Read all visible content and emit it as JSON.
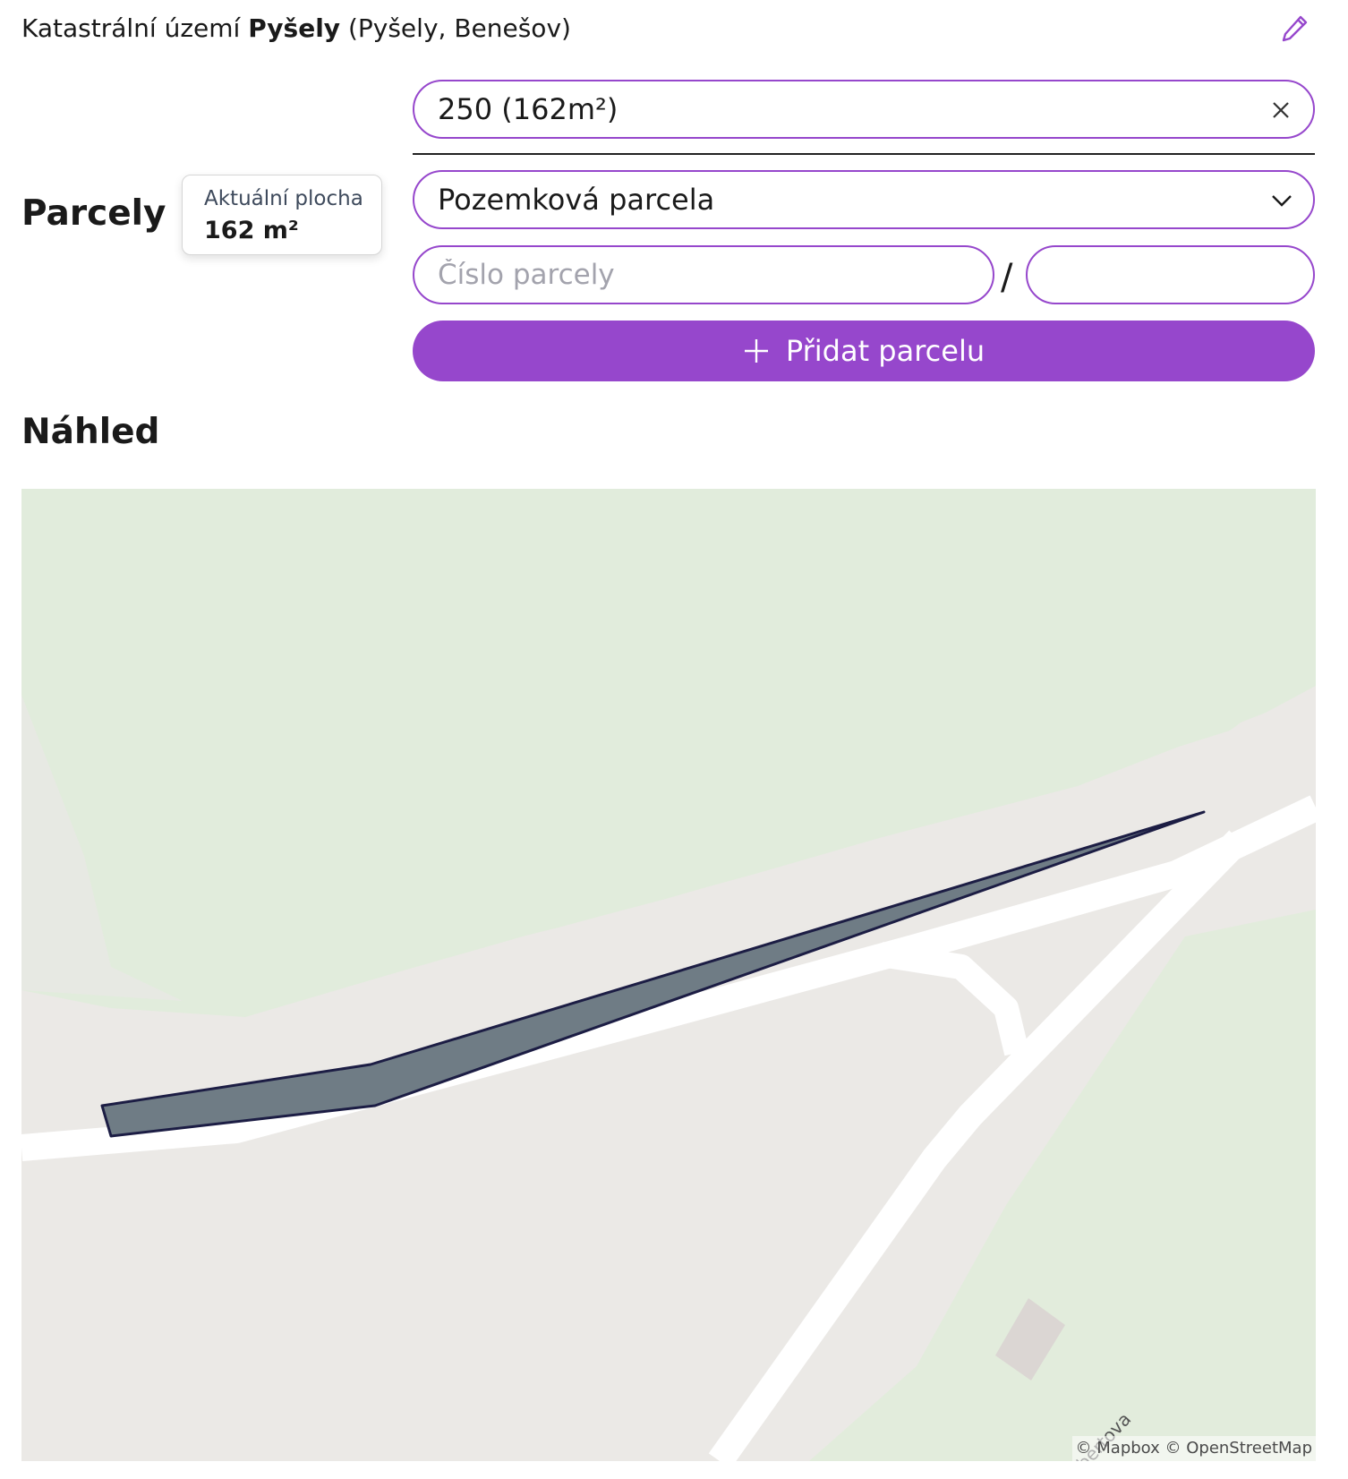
{
  "header": {
    "prefix": "Katastrální území",
    "territory": "Pyšely",
    "suffix": "(Pyšely, Benešov)",
    "edit_icon": "pencil-icon"
  },
  "parcels": {
    "title": "Parcely",
    "area_card": {
      "label": "Aktuální plocha",
      "value": "162 m²"
    },
    "selected_parcel": "250 (162m²)",
    "clear_icon": "close-icon",
    "parcel_type": "Pozemková parcela",
    "number_placeholder": "Číslo parcely",
    "number_value": "",
    "separator": "/",
    "subnumber_value": "",
    "add_button_label": "Přidat parcelu",
    "add_icon": "plus-icon"
  },
  "preview": {
    "title": "Náhled",
    "map": {
      "street_label": "Hubertova",
      "attribution": "© Mapbox © OpenStreetMap"
    }
  },
  "colors": {
    "accent": "#9647cc",
    "map_land": "#ebe9e6",
    "map_green": "#e0eddb",
    "map_road": "#ffffff",
    "parcel_fill": "#6f7c85",
    "parcel_stroke": "#1c1d44"
  }
}
